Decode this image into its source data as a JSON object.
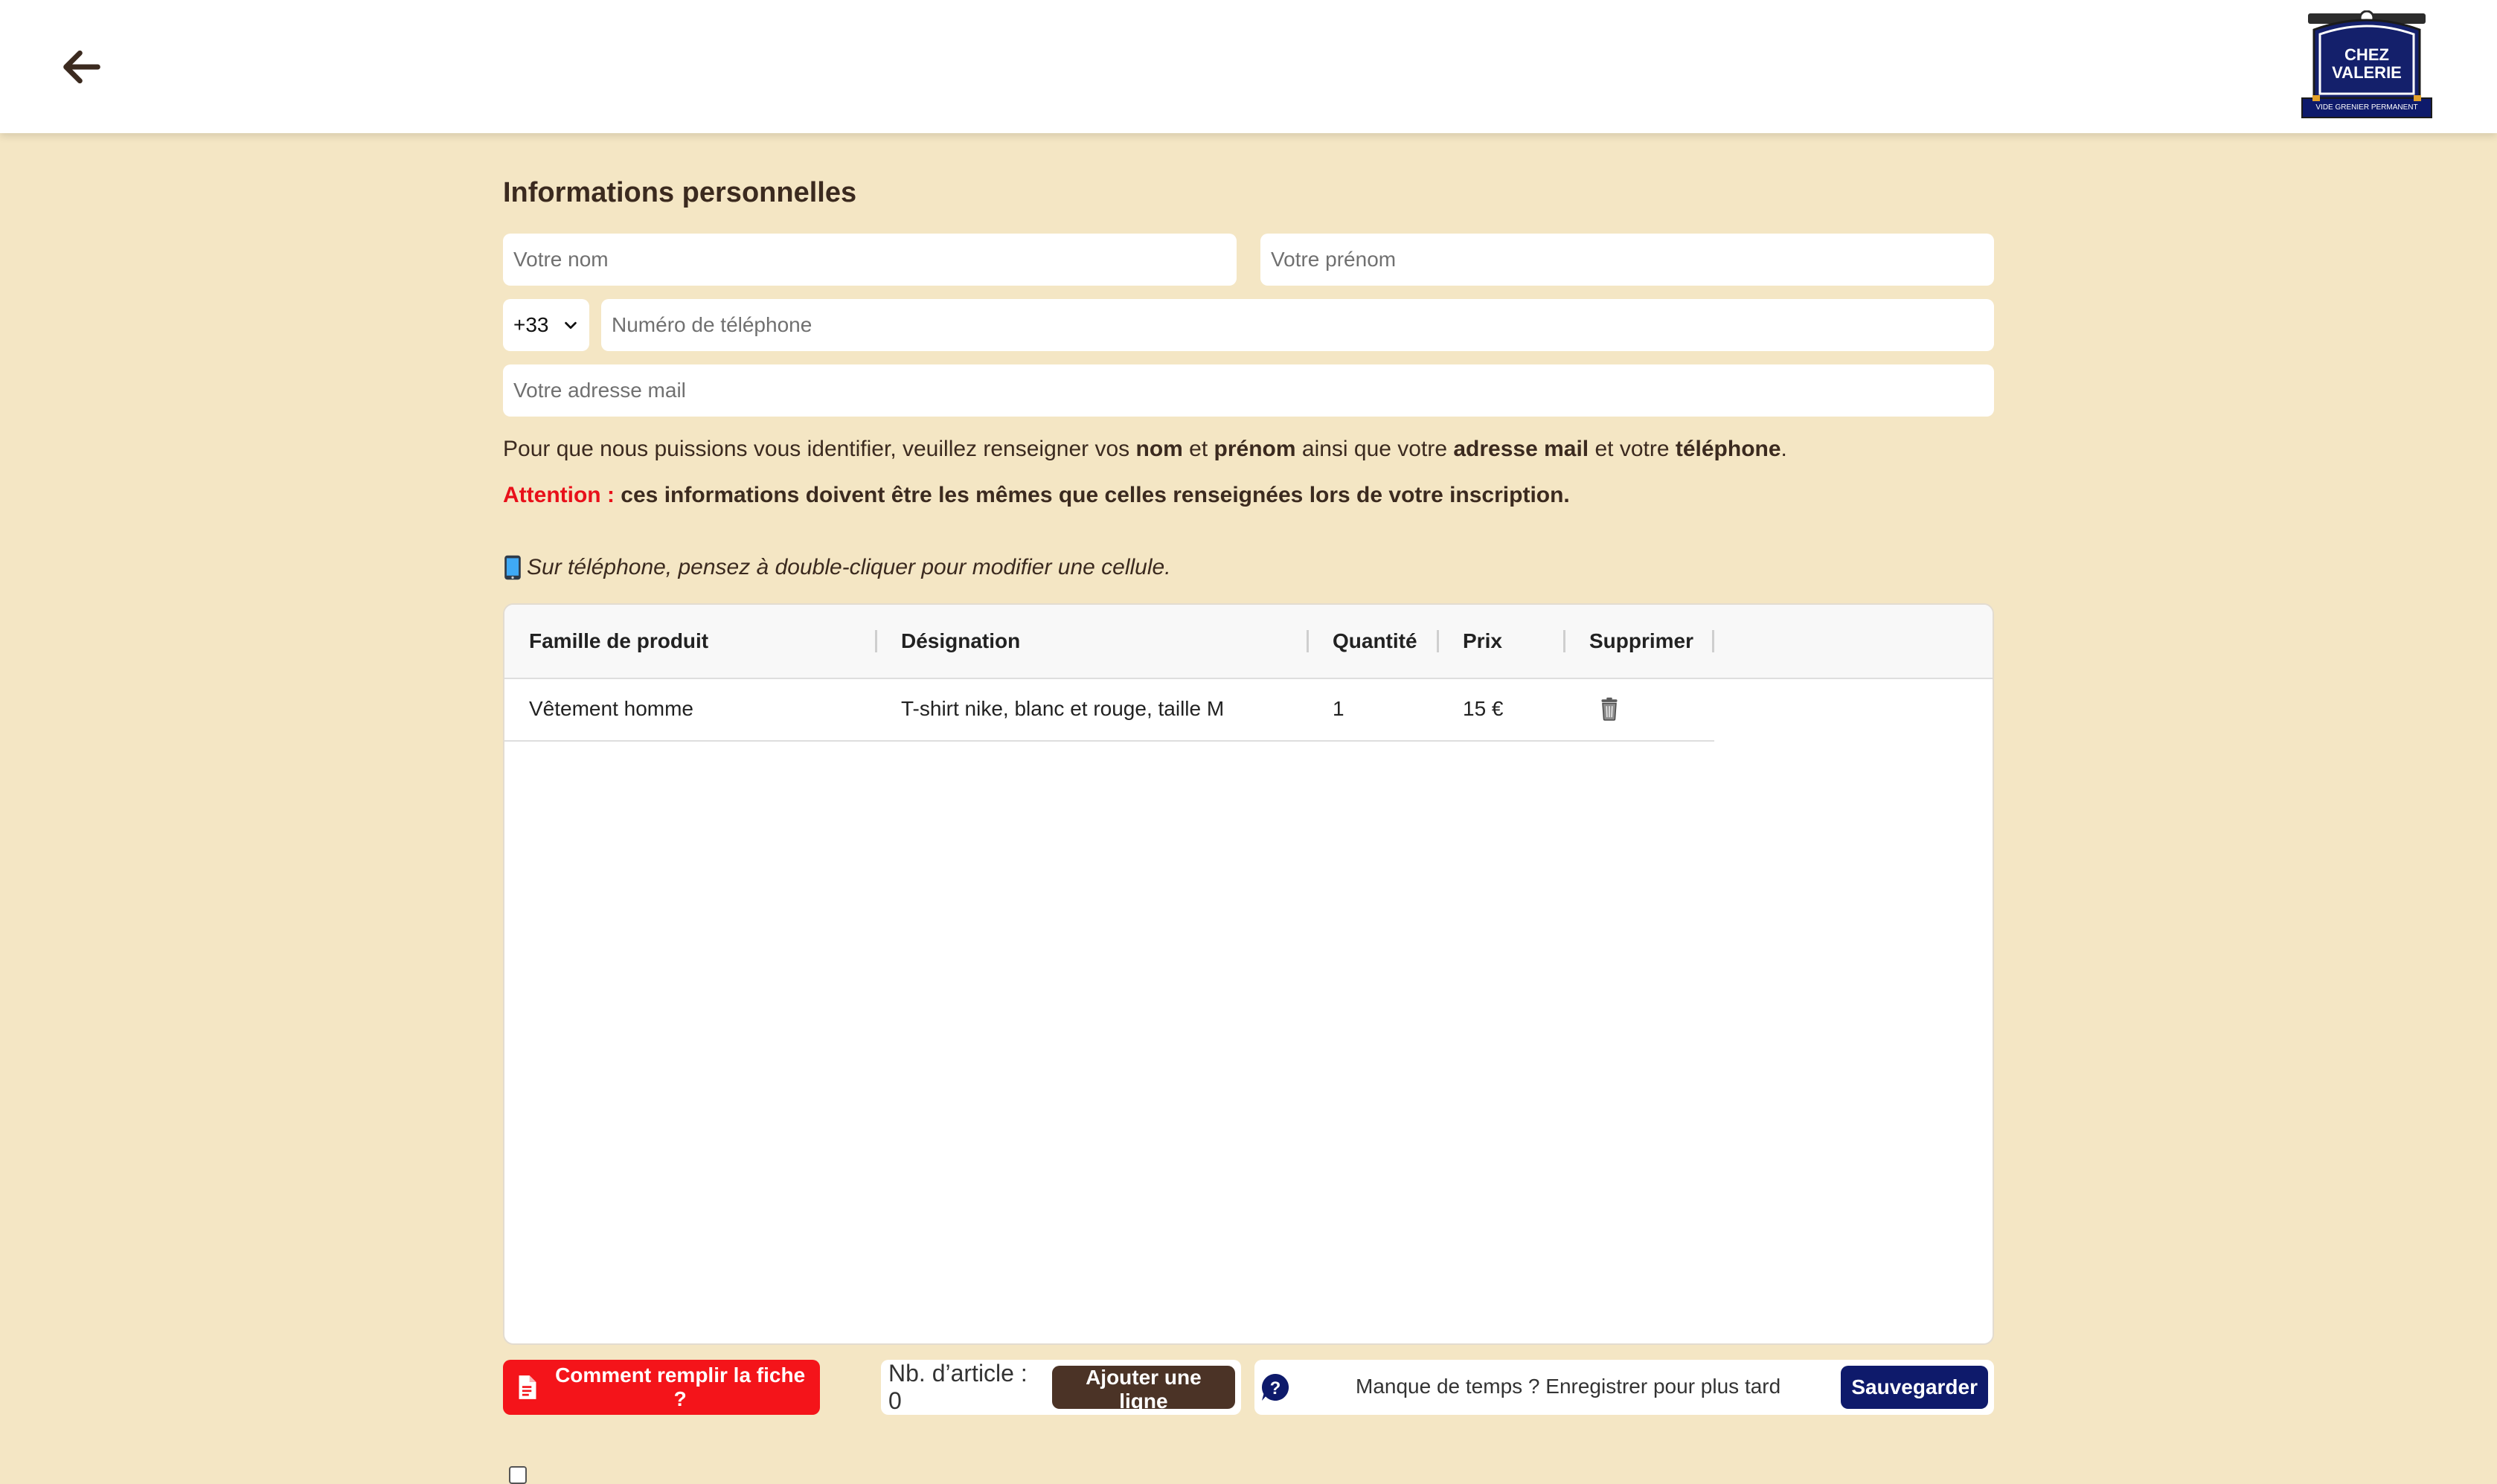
{
  "header": {
    "back_icon": "arrow-left-icon",
    "logo": {
      "line1": "CHEZ",
      "line2": "VALERIE",
      "tagline": "VIDE GRENIER PERMANENT"
    }
  },
  "personal_info": {
    "title": "Informations personnelles",
    "last_name_placeholder": "Votre nom",
    "first_name_placeholder": "Votre prénom",
    "country_code": "+33",
    "phone_placeholder": "Numéro de téléphone",
    "email_placeholder": "Votre adresse mail"
  },
  "info_text": {
    "part1": "Pour que nous puissions vous identifier, veuillez renseigner vos ",
    "b1": "nom",
    "part2": " et ",
    "b2": "prénom",
    "part3": " ainsi que votre ",
    "b3": "adresse mail",
    "part4": " et votre ",
    "b4": "téléphone",
    "part5": "."
  },
  "attention": {
    "label": "Attention :",
    "text": " ces informations doivent être les mêmes que celles renseignées lors de votre inscription."
  },
  "mobile_hint": {
    "icon": "phone-icon",
    "text": "Sur téléphone, pensez à double-cliquer pour modifier une cellule."
  },
  "table": {
    "columns": [
      "Famille de produit",
      "Désignation",
      "Quantité",
      "Prix",
      "Supprimer"
    ],
    "rows": [
      {
        "family": "Vêtement homme",
        "designation": "T-shirt nike, blanc et rouge, taille M",
        "quantity": "1",
        "price": "15 €",
        "delete_icon": "trash-icon"
      }
    ]
  },
  "footer": {
    "help_button": "Comment remplir la fiche ?",
    "help_icon": "document-icon",
    "article_count": "Nb. d’article : 0",
    "add_row_button": "Ajouter une ligne",
    "question_icon": "question-icon",
    "save_later_text": "Manque de temps ? Enregistrer pour plus tard",
    "save_button": "Sauvegarder"
  },
  "colors": {
    "background": "#f4e6c4",
    "text": "#3b2a1f",
    "attention": "#e8101a",
    "help_button": "#f4141a",
    "add_button": "#4b3326",
    "save_button": "#0e1a6b"
  }
}
